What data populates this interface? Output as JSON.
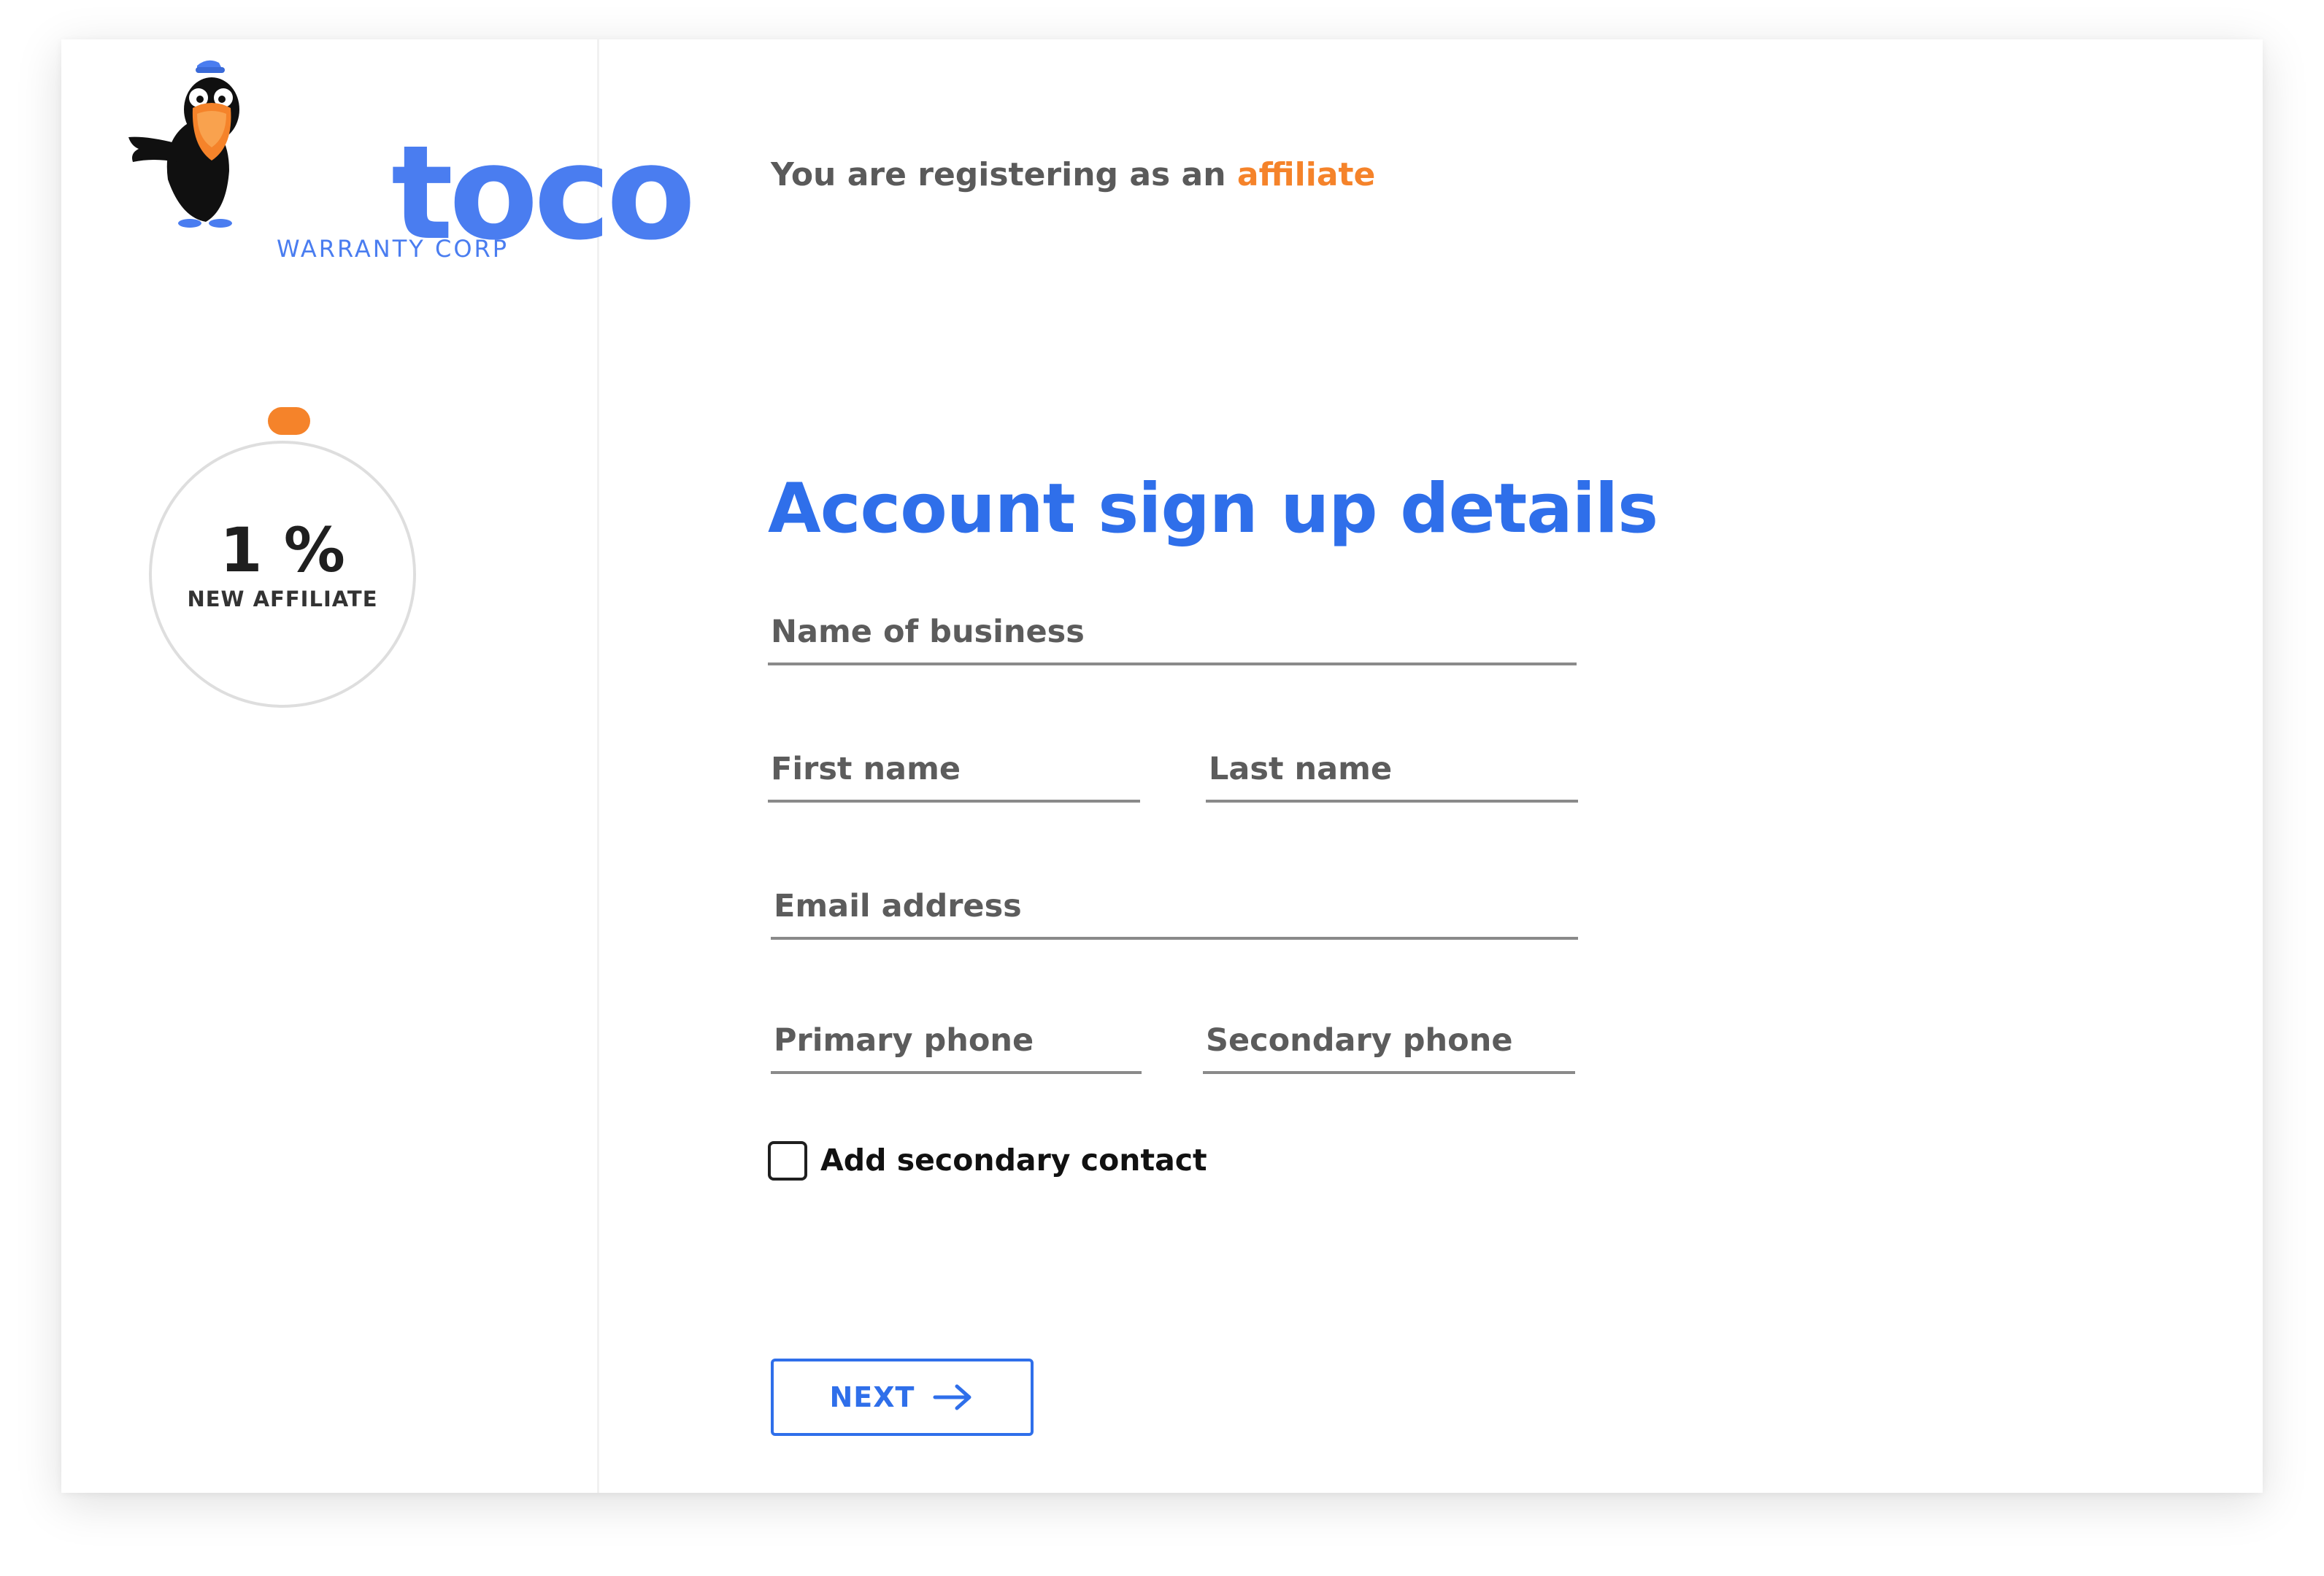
{
  "brand": {
    "name": "toco",
    "subtitle": "WARRANTY CORP"
  },
  "progress": {
    "value_percent": 1,
    "display": "1 %",
    "label": "NEW AFFILIATE"
  },
  "header": {
    "registering_prefix": "You are registering as an ",
    "role": "affiliate"
  },
  "form": {
    "title": "Account sign up details",
    "fields": {
      "business_name": {
        "placeholder": "Name of business",
        "value": ""
      },
      "first_name": {
        "placeholder": "First name",
        "value": ""
      },
      "last_name": {
        "placeholder": "Last name",
        "value": ""
      },
      "email": {
        "placeholder": "Email address",
        "value": ""
      },
      "primary_phone": {
        "placeholder": "Primary phone",
        "value": ""
      },
      "secondary_phone": {
        "placeholder": "Secondary phone",
        "value": ""
      }
    },
    "secondary_contact": {
      "label": "Add secondary contact",
      "checked": false
    },
    "next_label": "NEXT"
  },
  "colors": {
    "brand_blue": "#4a7df0",
    "primary_blue": "#2f6fea",
    "accent_orange": "#f5832a"
  },
  "icons": {
    "logo": "toucan-mascot-icon",
    "next": "arrow-right-icon"
  }
}
